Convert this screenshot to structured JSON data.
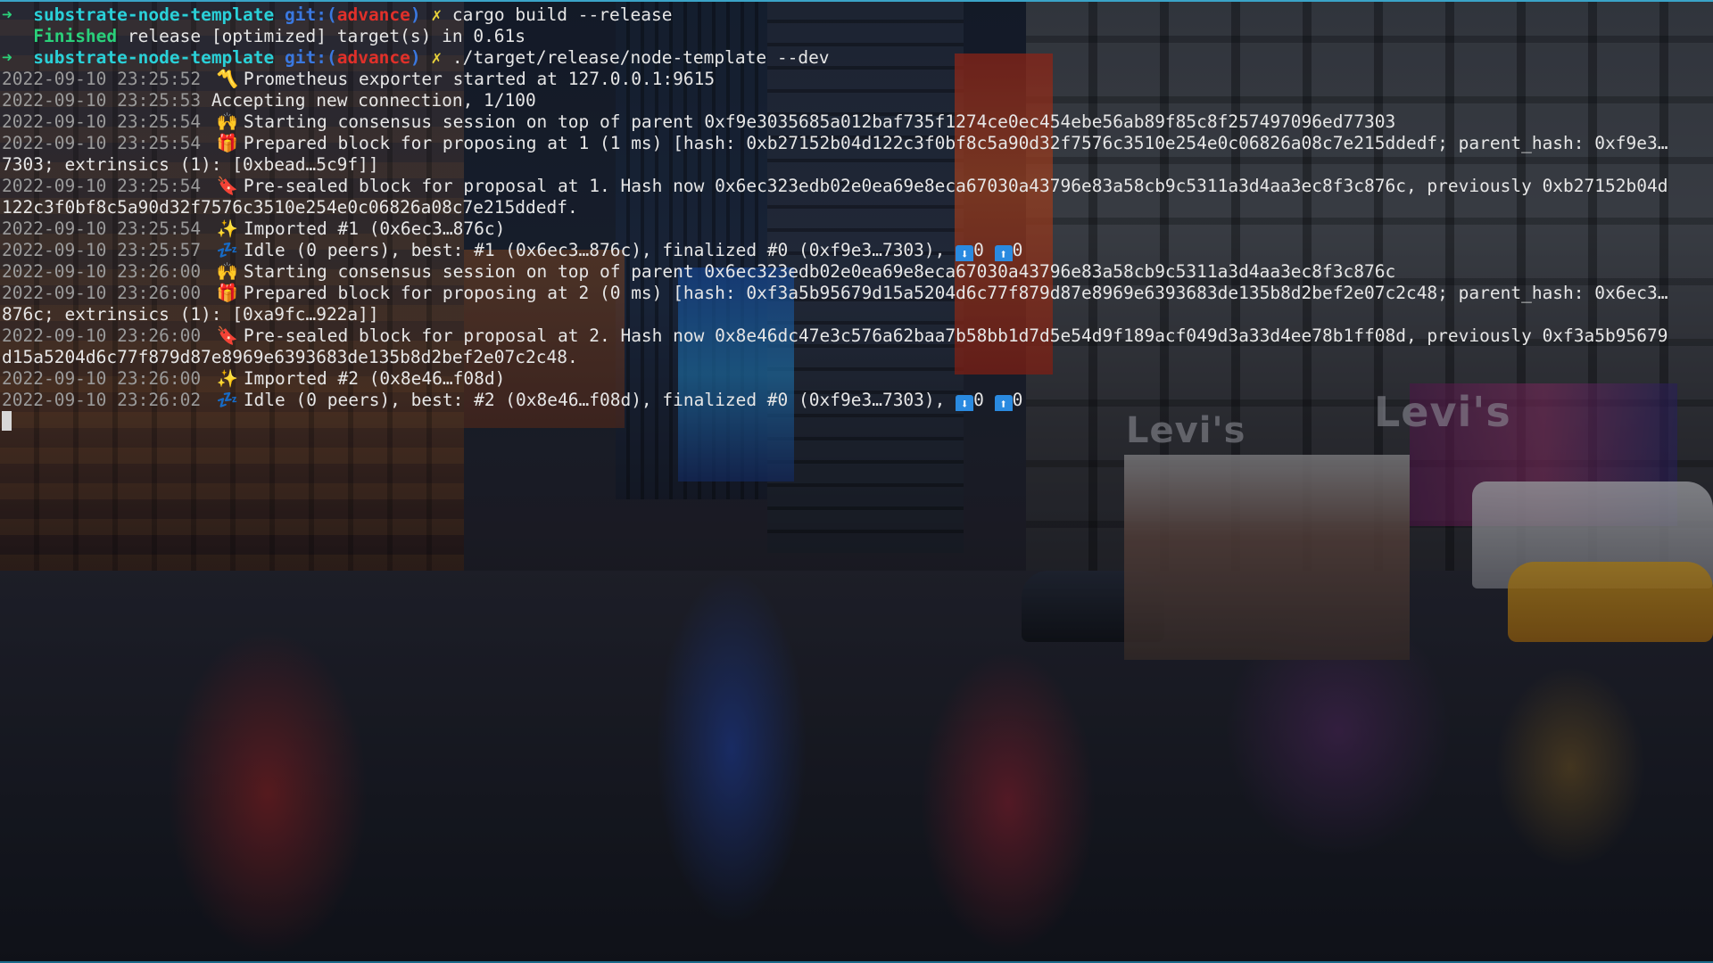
{
  "prompt": {
    "arrow": "➜",
    "directory": "substrate-node-template",
    "git_open": "git:(",
    "branch": "advance",
    "git_close": ")",
    "dirty_mark": "✗"
  },
  "commands": [
    "cargo build --release",
    "./target/release/node-template --dev"
  ],
  "build_output": {
    "status": "Finished",
    "text": "release [optimized] target(s) in 0.61s"
  },
  "log": [
    {
      "ts": "2022-09-10 23:25:52",
      "icon": "〽️",
      "text": "Prometheus exporter started at 127.0.0.1:9615"
    },
    {
      "ts": "2022-09-10 23:25:53",
      "icon": "",
      "text": "Accepting new connection, 1/100"
    },
    {
      "ts": "2022-09-10 23:25:54",
      "icon": "🙌",
      "text": "Starting consensus session on top of parent 0xf9e3035685a012baf735f1274ce0ec454ebe56ab89f85c8f257497096ed77303"
    },
    {
      "ts": "2022-09-10 23:25:54",
      "icon": "🎁",
      "text": "Prepared block for proposing at 1 (1 ms) [hash: 0xb27152b04d122c3f0bf8c5a90d32f7576c3510e254e0c06826a08c7e215ddedf; parent_hash: 0xf9e3…"
    },
    {
      "ts": "",
      "icon": "",
      "text": "7303; extrinsics (1): [0xbead…5c9f]]"
    },
    {
      "ts": "2022-09-10 23:25:54",
      "icon": "🔖",
      "text": "Pre-sealed block for proposal at 1. Hash now 0x6ec323edb02e0ea69e8eca67030a43796e83a58cb9c5311a3d4aa3ec8f3c876c, previously 0xb27152b04d"
    },
    {
      "ts": "",
      "icon": "",
      "text": "122c3f0bf8c5a90d32f7576c3510e254e0c06826a08c7e215ddedf."
    },
    {
      "ts": "2022-09-10 23:25:54",
      "icon": "✨",
      "text": "Imported #1 (0x6ec3…876c)"
    },
    {
      "ts": "2022-09-10 23:25:57",
      "icon": "💤",
      "text": "Idle (0 peers), best: #1 (0x6ec3…876c), finalized #0 (0xf9e3…7303), ",
      "down": "⬇",
      "down_count": "0",
      "up": "⬆",
      "up_count": "0"
    },
    {
      "ts": "2022-09-10 23:26:00",
      "icon": "🙌",
      "text": "Starting consensus session on top of parent 0x6ec323edb02e0ea69e8eca67030a43796e83a58cb9c5311a3d4aa3ec8f3c876c"
    },
    {
      "ts": "2022-09-10 23:26:00",
      "icon": "🎁",
      "text": "Prepared block for proposing at 2 (0 ms) [hash: 0xf3a5b95679d15a5204d6c77f879d87e8969e6393683de135b8d2bef2e07c2c48; parent_hash: 0x6ec3…"
    },
    {
      "ts": "",
      "icon": "",
      "text": "876c; extrinsics (1): [0xa9fc…922a]]"
    },
    {
      "ts": "2022-09-10 23:26:00",
      "icon": "🔖",
      "text": "Pre-sealed block for proposal at 2. Hash now 0x8e46dc47e3c576a62baa7b58bb1d7d5e54d9f189acf049d3a33d4ee78b1ff08d, previously 0xf3a5b95679"
    },
    {
      "ts": "",
      "icon": "",
      "text": "d15a5204d6c77f879d87e8969e6393683de135b8d2bef2e07c2c48."
    },
    {
      "ts": "2022-09-10 23:26:00",
      "icon": "✨",
      "text": "Imported #2 (0x8e46…f08d)"
    },
    {
      "ts": "2022-09-10 23:26:02",
      "icon": "💤",
      "text": "Idle (0 peers), best: #2 (0x8e46…f08d), finalized #0 (0xf9e3…7303), ",
      "down": "⬇",
      "down_count": "0",
      "up": "⬆",
      "up_count": "0"
    }
  ],
  "wallpaper_signs": [
    "Levi's",
    "Levi's"
  ]
}
